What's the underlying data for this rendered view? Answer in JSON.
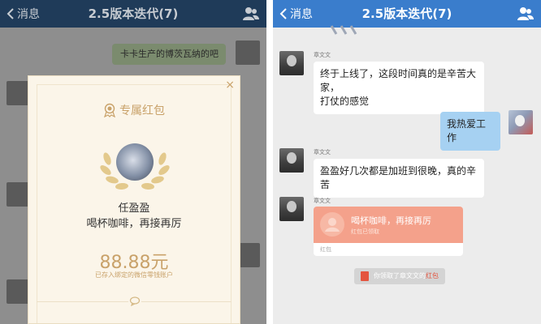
{
  "left": {
    "nav": {
      "back_label": "消息",
      "title": "2.5版本迭代(7)"
    },
    "dim_message": "卡卡生产的博茨瓦纳的吧",
    "red_packet": {
      "close": "×",
      "header": "专属红包",
      "sender": "任盈盈",
      "wish": "喝杯咖啡，再接再厉",
      "amount": "88.88元",
      "deposit_note": "已存入绑定的微信零钱账户"
    }
  },
  "right": {
    "nav": {
      "back_label": "消息",
      "title": "2.5版本迭代(7)"
    },
    "messages": [
      {
        "sender": "章文文",
        "text_line1": "终于上线了，这段时间真的是辛苦大家，",
        "text_line2": "打仗的感觉"
      },
      {
        "sender": "",
        "text_line1": "我热爱工作",
        "text_line2": ""
      },
      {
        "sender": "章文文",
        "text_line1": "盈盈好几次都是加班到很晚，真的辛苦",
        "text_line2": ""
      },
      {
        "sender": "章文文",
        "text_line1": "",
        "text_line2": ""
      }
    ],
    "red_packet_card": {
      "message": "喝杯咖啡，再接再厉",
      "status": "红包已领取",
      "footer": "红包"
    },
    "system_note": {
      "prefix": "你领取了章文文的",
      "link": "红包"
    }
  },
  "colors": {
    "left_nav": "#1f3b59",
    "right_nav": "#3a7dcc",
    "gold": "#c9a26a",
    "self_bubble": "#a6d1f2",
    "red_packet": "#f4a18b"
  }
}
